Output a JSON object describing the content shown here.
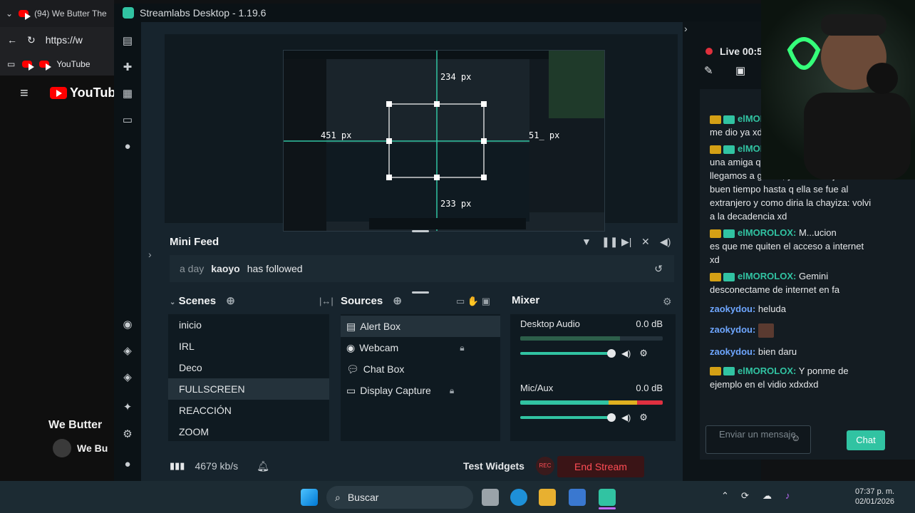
{
  "browser": {
    "tab_title": "(94) We Butter The",
    "url": "https://w",
    "bookmark": "YouTube",
    "logo_text": "YouTube",
    "video_title": "We Butter",
    "channel_text": "We Bu"
  },
  "app": {
    "title": "Streamlabs Desktop - 1.19.6"
  },
  "preview": {
    "measure_top": "234 px",
    "measure_left": "451 px",
    "measure_right": "51_ px",
    "measure_bottom": "233 px"
  },
  "mini_feed": {
    "title": "Mini Feed",
    "time": "a day",
    "user": "kaoyo",
    "event": "has followed"
  },
  "scenes": {
    "title": "Scenes",
    "items": [
      "inicio",
      "IRL",
      "Deco",
      "FULLSCREEN",
      "REACCIÓN",
      "ZOOM"
    ],
    "selected_index": 3
  },
  "sources": {
    "title": "Sources",
    "items": [
      "Alert Box",
      "Webcam",
      "Chat Box",
      "Display Capture"
    ],
    "selected_index": 0
  },
  "mixer": {
    "title": "Mixer",
    "channels": [
      {
        "name": "Desktop Audio",
        "db": "0.0 dB"
      },
      {
        "name": "Mic/Aux",
        "db": "0.0 dB"
      }
    ]
  },
  "footer": {
    "bitrate": "4679 kb/s",
    "test_widgets": "Test Widgets",
    "rec_label": "REC",
    "end_stream": "End Stream"
  },
  "live": {
    "status": "Live 00:50"
  },
  "chat": {
    "messages": [
      {
        "user": "elMOROLOX",
        "text": "",
        "cont": "me dio ya xd"
      },
      {
        "user": "elMOROLOX",
        "text": "",
        "cont": "una amiga q"
      },
      {
        "user": "",
        "text": "",
        "cont": "llegamos a gustar, y de ahi deje el xn* x"
      },
      {
        "user": "",
        "text": "",
        "cont": "buen tiempo hasta q ella se fue al"
      },
      {
        "user": "",
        "text": "",
        "cont": "extranjero y como diria la chayiza: volvi"
      },
      {
        "user": "",
        "text": "",
        "cont": "a la decadencia xd"
      },
      {
        "user": "elMOROLOX:",
        "text": "M...ucion",
        "cont": "es que me quiten el acceso a internet"
      },
      {
        "user": "",
        "text": "",
        "cont": "xd"
      },
      {
        "user": "elMOROLOX:",
        "text": "Gemini",
        "cont": "desconectame de internet en fa"
      },
      {
        "user2": "zaokydou:",
        "text": "heluda"
      },
      {
        "user2": "zaokydou:",
        "text": ""
      },
      {
        "user2": "zaokydou:",
        "text": "bien daru"
      },
      {
        "user": "elMOROLOX:",
        "text": "Y ponme de",
        "cont": "ejemplo en el vidio xdxdxd"
      }
    ],
    "input_placeholder": "Enviar un mensaje",
    "send_label": "Chat"
  },
  "taskbar": {
    "search_label": "Buscar",
    "time": "07:37 p. m.",
    "date": "02/01/2026"
  },
  "colors": {
    "accent": "#31c3a2",
    "end_stream": "#ff4d55",
    "window_bg": "#17242d"
  }
}
